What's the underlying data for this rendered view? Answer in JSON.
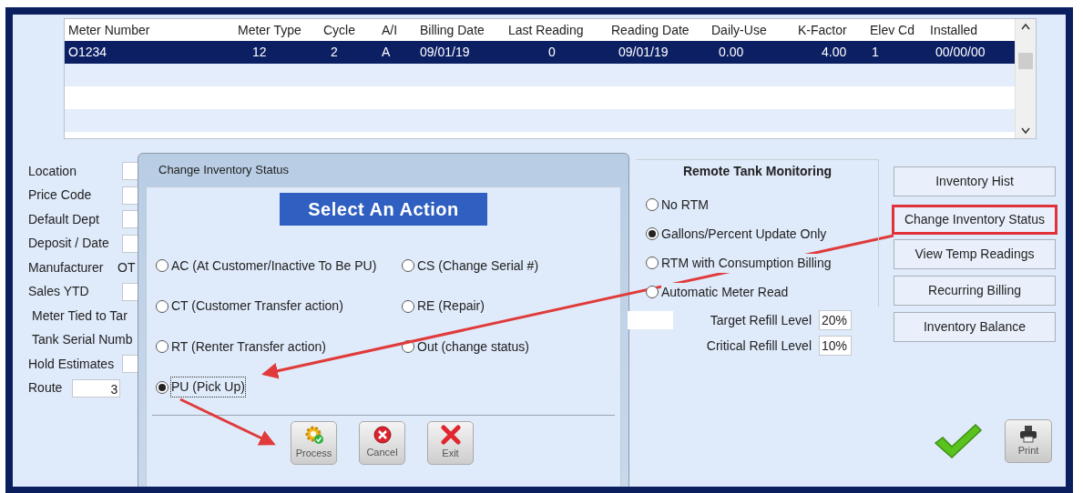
{
  "table": {
    "columns": [
      "Meter Number",
      "Meter Type",
      "Cycle",
      "A/I",
      "Billing Date",
      "Last Reading",
      "Reading Date",
      "Daily-Use",
      "K-Factor",
      "Elev Cd",
      "Installed"
    ],
    "rows": [
      {
        "selected": true,
        "cells": [
          "O1234",
          "12",
          "2",
          "A",
          "09/01/19",
          "0",
          "09/01/19",
          "0.00",
          "4.00",
          "1",
          "00/00/00"
        ]
      }
    ]
  },
  "form": [
    {
      "kind": "input",
      "label": "Location"
    },
    {
      "kind": "input",
      "label": "Price Code"
    },
    {
      "kind": "input",
      "label": "Default Dept"
    },
    {
      "kind": "input",
      "label": "Deposit / Date"
    },
    {
      "kind": "text",
      "label": "Manufacturer",
      "value": "OT"
    },
    {
      "kind": "input",
      "label": "Sales YTD"
    },
    {
      "kind": "label",
      "label": "Meter Tied to Tar"
    },
    {
      "kind": "label",
      "label": "Tank Serial Numb"
    },
    {
      "kind": "input",
      "label": "Hold Estimates"
    },
    {
      "kind": "short",
      "label": "Route",
      "value": "3"
    }
  ],
  "rtm": {
    "title": "Remote Tank Monitoring",
    "options": [
      {
        "label": "No RTM",
        "selected": false
      },
      {
        "label": "Gallons/Percent Update Only",
        "selected": true
      },
      {
        "label": "RTM with Consumption Billing",
        "selected": false
      },
      {
        "label": "Automatic Meter Read",
        "selected": false
      }
    ]
  },
  "refill": [
    {
      "label": "Target Refill Level",
      "value": "20%"
    },
    {
      "label": "Critical Refill Level",
      "value": "10%"
    }
  ],
  "side_buttons": [
    {
      "label": "Inventory Hist",
      "highlighted": false
    },
    {
      "label": "Change Inventory Status",
      "highlighted": true
    },
    {
      "label": "View Temp Readings",
      "highlighted": false
    },
    {
      "label": "Recurring Billing",
      "highlighted": false
    },
    {
      "label": "Inventory Balance",
      "highlighted": false
    }
  ],
  "print_button": {
    "label": "Print"
  },
  "dialog": {
    "title": "Change Inventory Status",
    "heading": "Select An Action",
    "options": [
      {
        "label": "AC (At Customer/Inactive To Be PU)",
        "selected": false
      },
      {
        "label": "CS (Change Serial #)",
        "selected": false
      },
      {
        "label": "CT (Customer Transfer action)",
        "selected": false
      },
      {
        "label": "RE (Repair)",
        "selected": false
      },
      {
        "label": "RT (Renter Transfer action)",
        "selected": false
      },
      {
        "label": "Out (change status)",
        "selected": false
      },
      {
        "label": "PU (Pick Up)",
        "selected": true
      }
    ],
    "buttons": [
      {
        "kind": "process",
        "label": "Process"
      },
      {
        "kind": "cancel",
        "label": "Cancel"
      },
      {
        "kind": "exit",
        "label": "Exit"
      }
    ]
  }
}
